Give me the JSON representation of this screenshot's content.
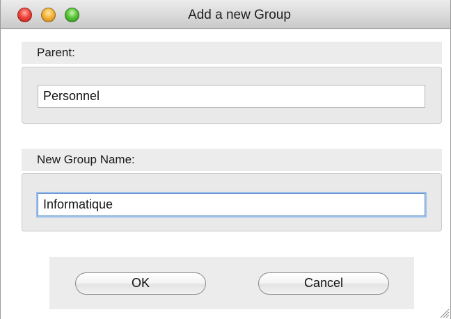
{
  "window": {
    "title": "Add a new Group"
  },
  "parent": {
    "label": "Parent:",
    "value": "Personnel"
  },
  "new_group": {
    "label": "New Group Name:",
    "value": "Informatique"
  },
  "buttons": {
    "ok_label": "OK",
    "cancel_label": "Cancel"
  },
  "icons": {
    "close": "close-icon",
    "minimize": "minimize-icon",
    "zoom": "zoom-icon",
    "resize": "resize-grip-icon"
  },
  "colors": {
    "close": "#f0443a",
    "minimize": "#f5b53a",
    "zoom": "#59c53a",
    "focus_ring": "#9cc0ea"
  }
}
